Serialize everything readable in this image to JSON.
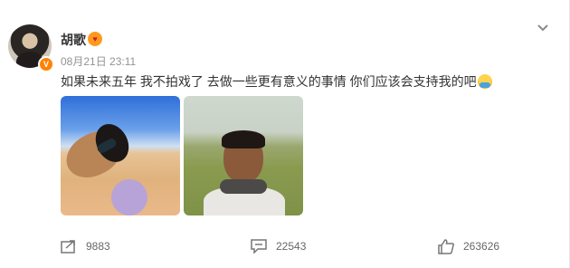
{
  "post": {
    "user": {
      "name": "胡歌",
      "verified_badge": "V"
    },
    "meta": {
      "time": "08月21日 23:11"
    },
    "content": {
      "text": "如果未来五年 我不拍戏了 去做一些更有意义的事情 你们应该会支持我的吧"
    },
    "images": [
      "desert-selfie",
      "field-selfie"
    ]
  },
  "actions": {
    "repost_count": "9883",
    "comment_count": "22543",
    "like_count": "263626"
  },
  "icons": {
    "repost": "share-icon",
    "comment": "comment-icon",
    "like": "thumbs-up-icon",
    "more": "chevron-down-icon",
    "fans": "fan-badge-icon",
    "emoji": "hugging-emoji-icon"
  },
  "colors": {
    "accent": "#ff8200",
    "text": "#333333",
    "muted": "#939393"
  }
}
